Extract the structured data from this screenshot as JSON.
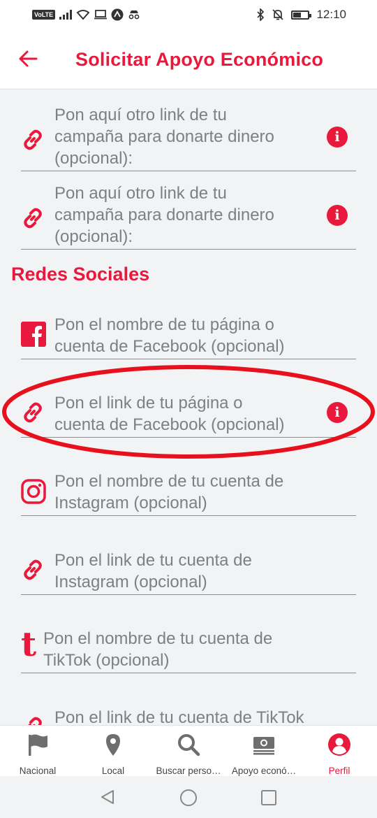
{
  "status_bar": {
    "volte": "VoLTE",
    "time": "12:10"
  },
  "app_bar": {
    "title": "Solicitar Apoyo Económico"
  },
  "fields": [
    {
      "icon": "link-icon",
      "text_lines": [
        "Pon aquí otro link de tu",
        "campaña para donarte dinero",
        "(opcional):"
      ],
      "info": "i"
    },
    {
      "icon": "link-icon",
      "text_lines": [
        "Pon aquí otro link de tu",
        "campaña para donarte dinero",
        "(opcional):"
      ],
      "info": "i"
    }
  ],
  "social_section_title": "Redes Sociales",
  "social_fields": [
    {
      "icon": "facebook-icon",
      "text_lines": [
        "Pon el nombre de tu página o",
        "cuenta de Facebook (opcional)"
      ]
    },
    {
      "icon": "link-icon",
      "text_lines": [
        "Pon el link de tu página o",
        "cuenta de Facebook (opcional)"
      ],
      "info": "i"
    },
    {
      "icon": "instagram-icon",
      "text_lines": [
        "Pon el nombre de tu cuenta de",
        "Instagram (opcional)"
      ]
    },
    {
      "icon": "link-icon",
      "text_lines": [
        "Pon el link de tu cuenta de",
        "Instagram (opcional)"
      ]
    },
    {
      "icon": "tiktok-icon",
      "icon_glyph": "t",
      "text_lines": [
        "Pon el nombre de tu cuenta de",
        "TikTok (opcional)"
      ]
    },
    {
      "icon": "link-icon",
      "text_lines": [
        "Pon el link de tu cuenta de TikTok"
      ]
    }
  ],
  "bottom_nav": [
    {
      "icon": "flag-icon",
      "label": "Nacional",
      "active": false
    },
    {
      "icon": "location-pin-icon",
      "label": "Local",
      "active": false
    },
    {
      "icon": "search-icon",
      "label": "Buscar perso…",
      "active": false
    },
    {
      "icon": "money-icon",
      "label": "Apoyo econó…",
      "active": false
    },
    {
      "icon": "profile-icon",
      "label": "Perfil",
      "active": true
    }
  ],
  "colors": {
    "accent": "#e8193c",
    "placeholder": "#7b8187",
    "background": "#f1f3f4"
  }
}
